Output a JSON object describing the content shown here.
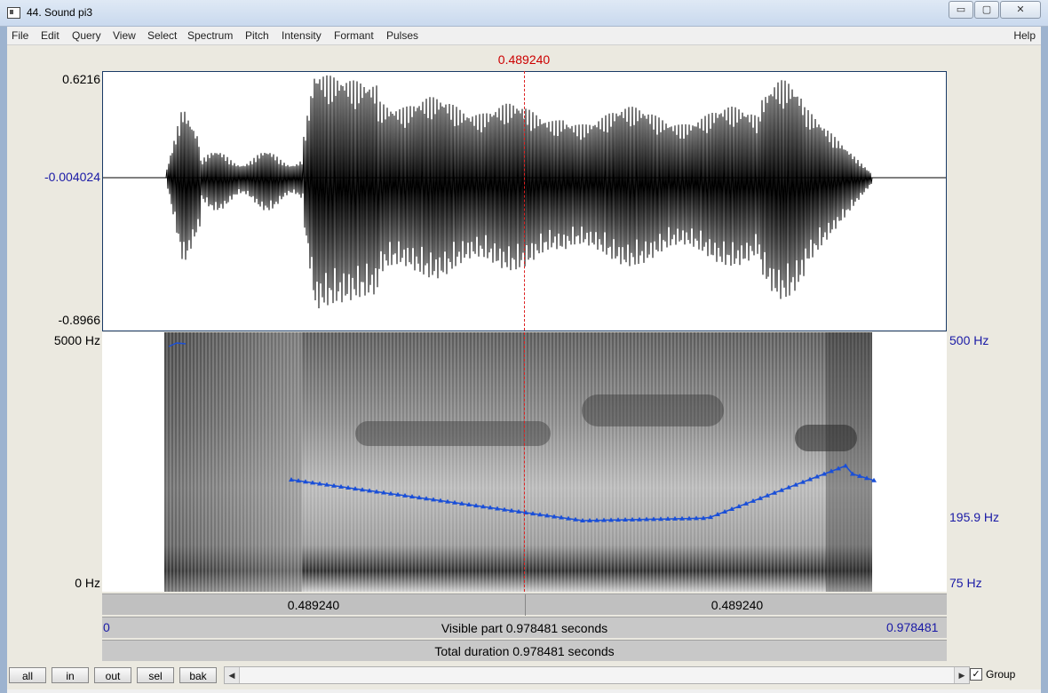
{
  "window": {
    "title": "44. Sound pi3",
    "buttons": {
      "minimize": "▭",
      "maximize": "▢",
      "close": "✕"
    }
  },
  "menu": {
    "items": [
      "File",
      "Edit",
      "Query",
      "View",
      "Select",
      "Spectrum",
      "Pitch",
      "Intensity",
      "Formant",
      "Pulses"
    ],
    "help": "Help"
  },
  "cursor": {
    "time_label": "0.489240",
    "time_seconds": 0.48924
  },
  "waveform": {
    "max_label": "0.6216",
    "mid_label": "-0.004024",
    "min_label": "-0.8966"
  },
  "spectrogram": {
    "freq_max_label": "5000 Hz",
    "freq_min_label": "0 Hz",
    "pitch_max_label": "500 Hz",
    "pitch_mid_label": "195.9 Hz",
    "pitch_min_label": "75 Hz"
  },
  "timebars": {
    "left_time": "0.489240",
    "right_time": "0.489240",
    "visible_start": "0",
    "visible_end": "0.978481",
    "visible_text": "Visible part 0.978481 seconds",
    "total_text": "Total duration 0.978481 seconds"
  },
  "toolbar": {
    "all": "all",
    "in": "in",
    "out": "out",
    "sel": "sel",
    "bak": "bak",
    "scroll_left": "◀",
    "scroll_right": "▶",
    "group_checked": "✓",
    "group_label": "Group"
  },
  "colors": {
    "cursor": "#cc0000",
    "pitch": "#1a4fd8",
    "axis_blue": "#1a1aa6"
  }
}
